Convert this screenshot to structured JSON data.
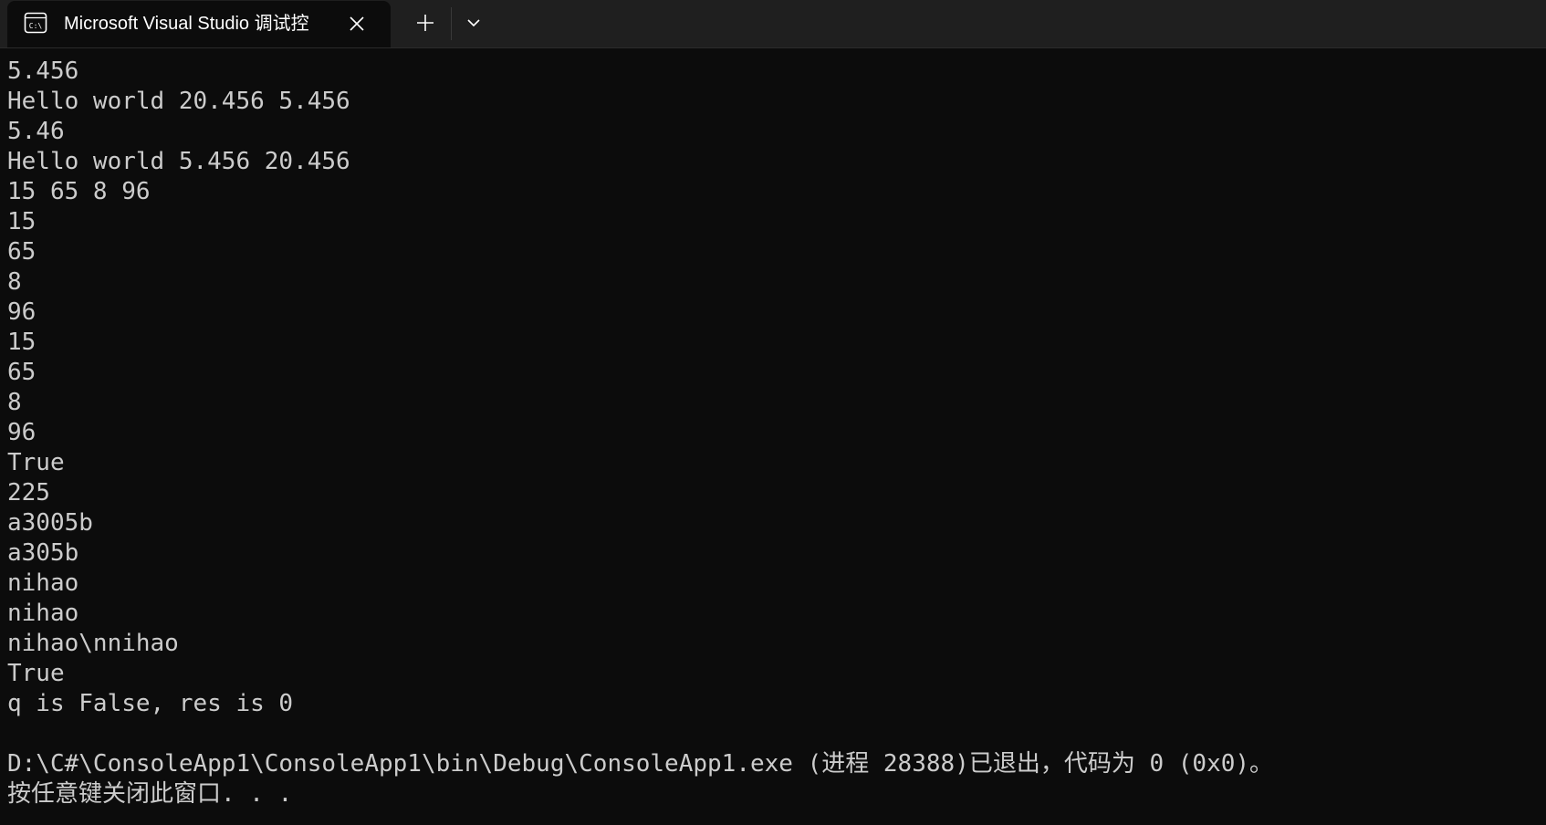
{
  "tab": {
    "title": "Microsoft Visual Studio 调试控",
    "icon": "console-icon",
    "close_icon": "close-icon"
  },
  "tabbar": {
    "new_tab_icon": "plus-icon",
    "dropdown_icon": "chevron-down-icon"
  },
  "colors": {
    "background": "#0c0c0c",
    "tabbar": "#1f1f1f",
    "text": "#cccccc",
    "title_text": "#ffffff"
  },
  "console": {
    "lines": [
      "5.456",
      "Hello world 20.456 5.456",
      "5.46",
      "Hello world 5.456 20.456",
      "15 65 8 96",
      "15",
      "65",
      "8",
      "96",
      "15",
      "65",
      "8",
      "96",
      "True",
      "225",
      "a3005b",
      "a305b",
      "nihao",
      "nihao",
      "nihao\\nnihao",
      "True",
      "q is False, res is 0",
      "",
      "D:\\C#\\ConsoleApp1\\ConsoleApp1\\bin\\Debug\\ConsoleApp1.exe (进程 28388)已退出，代码为 0 (0x0)。",
      "按任意键关闭此窗口. . ."
    ]
  }
}
